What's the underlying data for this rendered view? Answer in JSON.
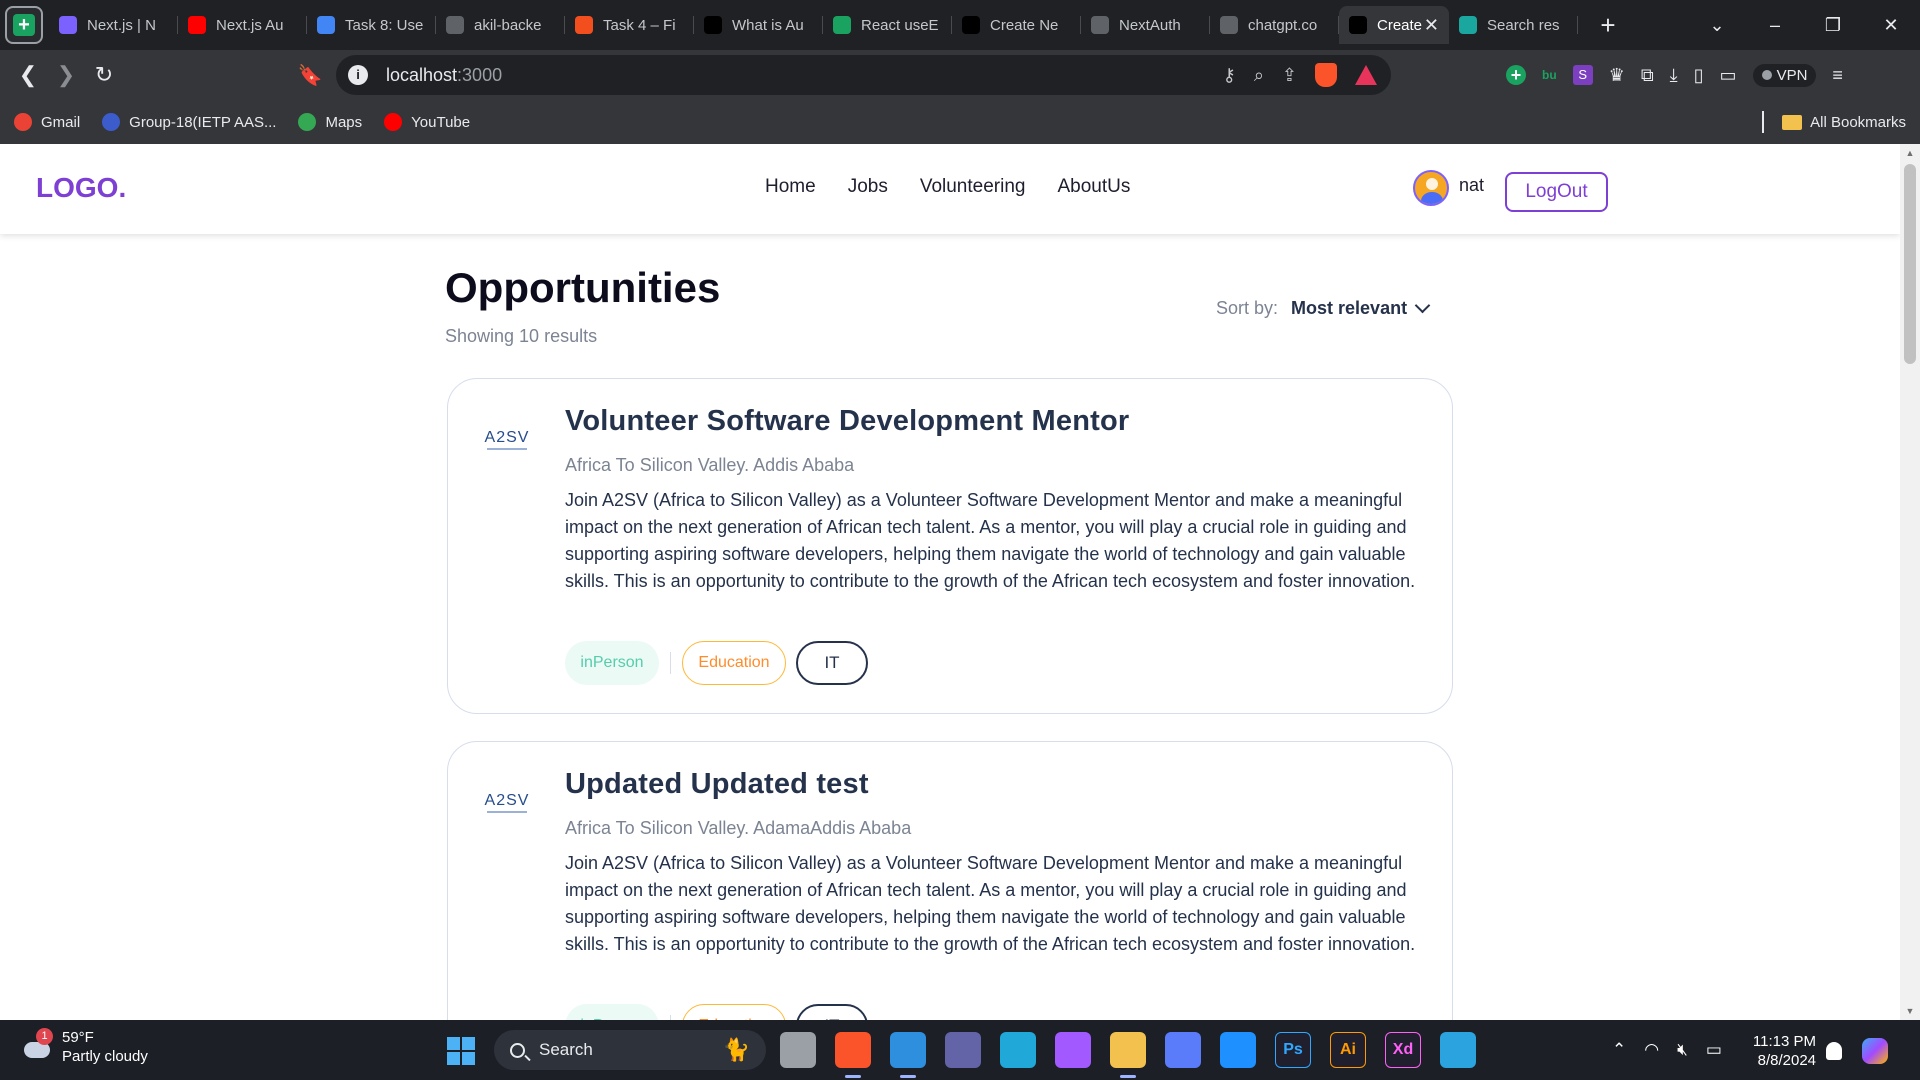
{
  "browser": {
    "tabs": [
      {
        "title": "Next.js | N",
        "fav_color": "#7b61ff"
      },
      {
        "title": "Next.js Au",
        "fav_color": "#ff0000"
      },
      {
        "title": "Task 8: Use",
        "fav_color": "#4285f4"
      },
      {
        "title": "akil-backe",
        "fav_color": "#5f6368"
      },
      {
        "title": "Task 4 – Fi",
        "fav_color": "#f24e1e"
      },
      {
        "title": "What is Au",
        "fav_color": "#000000"
      },
      {
        "title": "React useE",
        "fav_color": "#1aa260"
      },
      {
        "title": "Create Ne",
        "fav_color": "#000000"
      },
      {
        "title": "NextAuth",
        "fav_color": "#5f6368"
      },
      {
        "title": "chatgpt.co",
        "fav_color": "#5f6368"
      },
      {
        "title": "Create",
        "fav_color": "#000000",
        "active": true
      },
      {
        "title": "Search res",
        "fav_color": "#1aa7a0"
      }
    ],
    "url_host": "localhost",
    "url_port": ":3000",
    "vpn_label": "VPN",
    "bookmarks": [
      {
        "label": "Gmail",
        "color": "#ea4335"
      },
      {
        "label": "Group-18(IETP AAS...",
        "color": "#3c5ccc"
      },
      {
        "label": "Maps",
        "color": "#34a853"
      },
      {
        "label": "YouTube",
        "color": "#ff0000"
      }
    ],
    "all_bookmarks_label": "All Bookmarks"
  },
  "site": {
    "logo": "LOGO.",
    "nav": [
      "Home",
      "Jobs",
      "Volunteering",
      "AboutUs"
    ],
    "user_name": "nat",
    "logout_label": "LogOut"
  },
  "main": {
    "title": "Opportunities",
    "results_text": "Showing 10 results",
    "sort_label": "Sort by:",
    "sort_value": "Most relevant",
    "cards": [
      {
        "logo_text": "A2SV",
        "title": "Volunteer Software Development Mentor",
        "org": "Africa To Silicon Valley. Addis Ababa",
        "description": "Join A2SV (Africa to Silicon Valley) as a Volunteer Software Development Mentor and make a meaningful impact on the next generation of African tech talent. As a mentor, you will play a crucial role in guiding and supporting aspiring software developers, helping them navigate the world of technology and gain valuable skills. This is an opportunity to contribute to the growth of the African tech ecosystem and foster innovation.",
        "tags": [
          "inPerson",
          "Education",
          "IT"
        ]
      },
      {
        "logo_text": "A2SV",
        "title": "Updated Updated test",
        "org": "Africa To Silicon Valley. AdamaAddis Ababa",
        "description": "Join A2SV (Africa to Silicon Valley) as a Volunteer Software Development Mentor and make a meaningful impact on the next generation of African tech talent. As a mentor, you will play a crucial role in guiding and supporting aspiring software developers, helping them navigate the world of technology and gain valuable skills. This is an opportunity to contribute to the growth of the African tech ecosystem and foster innovation.",
        "tags": [
          "inPerson",
          "Education",
          "IT"
        ]
      }
    ]
  },
  "taskbar": {
    "temperature": "59°F",
    "weather": "Partly cloudy",
    "weather_badge": "1",
    "search_label": "Search",
    "time": "11:13 PM",
    "date": "8/8/2024",
    "apps": [
      {
        "name": "file-explorer-dark-icon",
        "color": "#9aa0a6",
        "label": ""
      },
      {
        "name": "brave-icon",
        "color": "#fb542b",
        "label": "",
        "active": true
      },
      {
        "name": "vscode-icon",
        "color": "#2f8fdf",
        "label": "",
        "active": true
      },
      {
        "name": "teams-icon",
        "color": "#6264a7",
        "label": ""
      },
      {
        "name": "edge-icon",
        "color": "#1fa8d8",
        "label": ""
      },
      {
        "name": "figma-icon",
        "color": "#a259ff",
        "label": ""
      },
      {
        "name": "file-explorer-icon",
        "color": "#f2c14e",
        "label": "",
        "active": true
      },
      {
        "name": "app-icon",
        "color": "#5b7cfa",
        "label": ""
      },
      {
        "name": "framer-icon",
        "color": "#1e90ff",
        "label": ""
      },
      {
        "name": "photoshop-icon",
        "color": "#31a8ff",
        "label": "Ps"
      },
      {
        "name": "illustrator-icon",
        "color": "#ff9a00",
        "label": "Ai"
      },
      {
        "name": "xd-icon",
        "color": "#ff61f6",
        "label": "Xd"
      },
      {
        "name": "telegram-icon",
        "color": "#2aa3df",
        "label": ""
      }
    ]
  }
}
